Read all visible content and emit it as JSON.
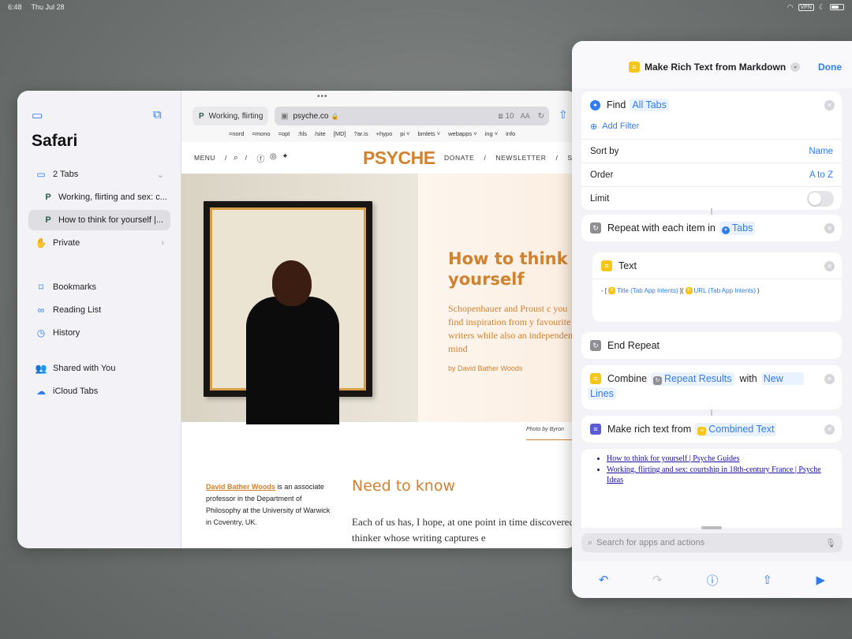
{
  "status": {
    "time": "6:48",
    "date": "Thu Jul 28",
    "vpn": "VPN"
  },
  "safari_sidebar": {
    "title": "Safari",
    "tabs_group": "2 Tabs",
    "tabs": [
      "Working, flirting and sex: c...",
      "How to think for yourself |..."
    ],
    "private": "Private",
    "bookmarks": "Bookmarks",
    "reading_list": "Reading List",
    "history": "History",
    "shared": "Shared with You",
    "icloud": "iCloud Tabs"
  },
  "toolbar": {
    "tab_title": "Working, flirting",
    "url": "psyche.co",
    "ext_count": "10",
    "aa": "AA",
    "bookmarks_bar": [
      "=nord",
      "=mono",
      "=opt",
      ":hls",
      "/site",
      "[MD]",
      "?ar.is",
      "+hypo",
      "pi ˅",
      "bmlets ˅",
      "webapps ˅",
      "ing ˅",
      "info"
    ]
  },
  "article": {
    "menu": "MENU",
    "slash1": "/",
    "slash2": "/",
    "logo": "PSYCHE",
    "donate": "DONATE",
    "newsletter": "NEWSLETTER",
    "sign": "SIG",
    "title": "How to think f yourself",
    "subtitle": "Schopenhauer and Proust c you find inspiration from y favourite writers while also an independent mind",
    "byline": "by David Bather Woods",
    "photo_credit": "Photo by Byron",
    "author_name": "David Bather Woods",
    "author_bio": " is an associate professor in the Department of Philosophy at the University of Warwick in Coventry, UK.",
    "section": "Need to know",
    "body": "Each of us has, I hope, at one point in time discovered a thinker whose writing captures e"
  },
  "shortcuts": {
    "title": "Make Rich Text from Markdown",
    "done": "Done",
    "find": "Find",
    "find_tag": "All Tabs",
    "add_filter": "Add Filter",
    "sort_by": "Sort by",
    "sort_val": "Name",
    "order": "Order",
    "order_val": "A to Z",
    "limit": "Limit",
    "repeat": "Repeat with each item in",
    "repeat_tag": "Tabs",
    "text": "Text",
    "text_prefix": "- [",
    "chip_title": "Title (Tab App Intents)",
    "text_mid": "](",
    "chip_url": "URL (Tab App Intents)",
    "text_suffix": ")",
    "end_repeat": "End Repeat",
    "combine": "Combine",
    "combine_tag": "Repeat Results",
    "with": "with",
    "newlines_tag1": "New",
    "newlines_tag2": "Lines",
    "make_rich": "Make rich text from",
    "make_rich_tag": "Combined Text",
    "rich_items": [
      "How to think for yourself | Psyche Guides",
      "Working, flirting and sex: courtship in 18th-century France | Psyche Ideas"
    ],
    "search_placeholder": "Search for apps and actions"
  },
  "colors": {
    "accent": "#2f7cf6",
    "psyche_orange": "#d2812f",
    "shortcut_yellow": "#f5c518"
  }
}
